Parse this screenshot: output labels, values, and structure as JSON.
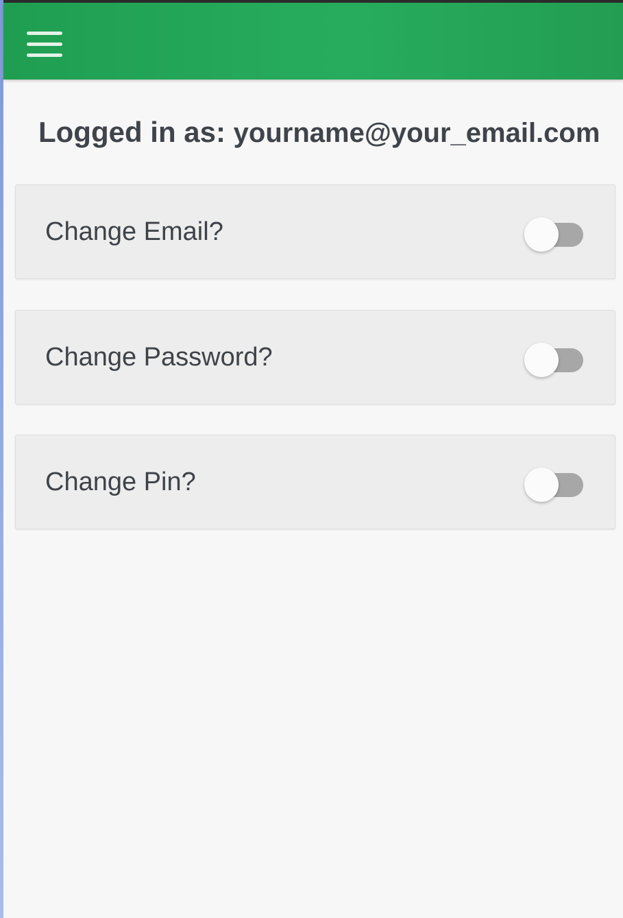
{
  "header": {
    "menu_icon": "hamburger-menu-icon",
    "color": "#22a558"
  },
  "account": {
    "label": "Logged in as:",
    "email": "yourname@your_email.com"
  },
  "settings": [
    {
      "label": "Change Email?",
      "enabled": false
    },
    {
      "label": "Change Password?",
      "enabled": false
    },
    {
      "label": "Change Pin?",
      "enabled": false
    }
  ]
}
